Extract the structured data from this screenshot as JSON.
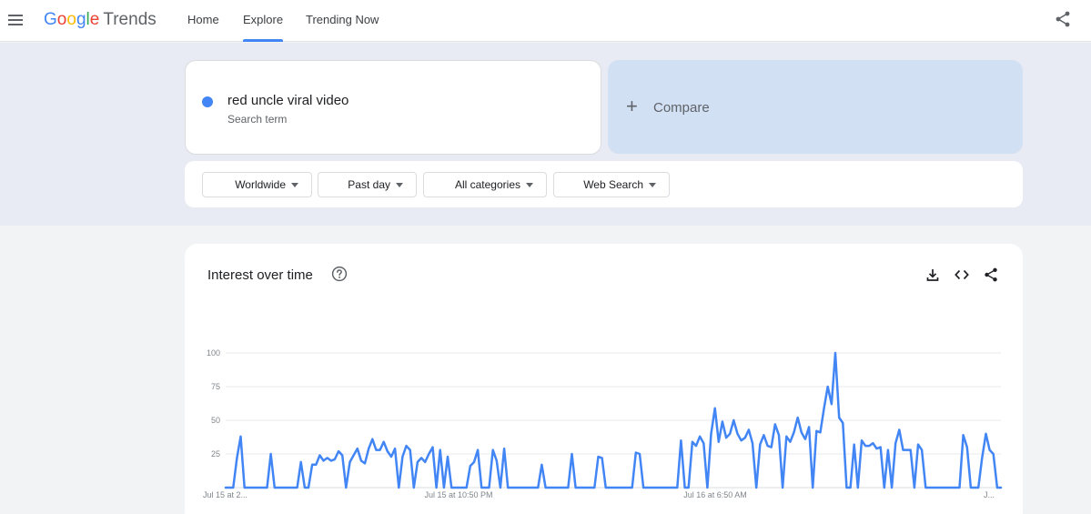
{
  "header": {
    "logo_letters": [
      "G",
      "o",
      "o",
      "g",
      "l",
      "e"
    ],
    "logo_product": "Trends",
    "tabs": [
      {
        "label": "Home",
        "active": false
      },
      {
        "label": "Explore",
        "active": true
      },
      {
        "label": "Trending Now",
        "active": false
      }
    ],
    "icons": {
      "menu": "menu-icon",
      "share": "share-icon"
    }
  },
  "search": {
    "term": {
      "name": "red uncle viral video",
      "subtitle": "Search term",
      "color": "#4285f4"
    },
    "compare": {
      "plus": "+",
      "label": "Compare"
    }
  },
  "filters": [
    {
      "label": "Worldwide"
    },
    {
      "label": "Past day"
    },
    {
      "label": "All categories"
    },
    {
      "label": "Web Search"
    }
  ],
  "chart_card": {
    "title": "Interest over time",
    "icons": [
      "help-icon",
      "download-icon",
      "embed-icon",
      "share-icon"
    ]
  },
  "chart_data": {
    "type": "line",
    "title": "Interest over time",
    "xlabel": "",
    "ylabel": "",
    "ylim": [
      0,
      100
    ],
    "yticks": [
      25,
      50,
      75,
      100
    ],
    "grid": true,
    "legend": "none",
    "x_tick_labels": [
      "Jul 15 at 2...",
      "Jul 15 at 10:50 PM",
      "Jul 16 at 6:50 AM",
      "J..."
    ],
    "series": [
      {
        "color": "#4285f4",
        "values": [
          0,
          0,
          0,
          22,
          38,
          0,
          0,
          0,
          0,
          0,
          0,
          0,
          25,
          0,
          0,
          0,
          0,
          0,
          0,
          0,
          19,
          0,
          0,
          17,
          17,
          24,
          20,
          22,
          20,
          21,
          27,
          24,
          0,
          19,
          24,
          29,
          20,
          18,
          29,
          36,
          28,
          28,
          34,
          27,
          23,
          29,
          0,
          23,
          31,
          28,
          0,
          19,
          22,
          19,
          25,
          30,
          0,
          28,
          0,
          23,
          0,
          0,
          0,
          0,
          0,
          16,
          19,
          28,
          0,
          0,
          0,
          28,
          20,
          0,
          29,
          0,
          0,
          0,
          0,
          0,
          0,
          0,
          0,
          0,
          17,
          0,
          0,
          0,
          0,
          0,
          0,
          0,
          25,
          0,
          0,
          0,
          0,
          0,
          0,
          23,
          22,
          0,
          0,
          0,
          0,
          0,
          0,
          0,
          0,
          26,
          25,
          0,
          0,
          0,
          0,
          0,
          0,
          0,
          0,
          0,
          0,
          35,
          0,
          0,
          34,
          31,
          38,
          33,
          0,
          40,
          59,
          34,
          49,
          37,
          40,
          50,
          40,
          35,
          37,
          43,
          33,
          0,
          32,
          39,
          31,
          30,
          47,
          39,
          0,
          38,
          34,
          41,
          52,
          41,
          36,
          45,
          0,
          42,
          41,
          59,
          75,
          62,
          100,
          52,
          48,
          0,
          0,
          32,
          0,
          35,
          31,
          31,
          33,
          29,
          30,
          0,
          28,
          0,
          33,
          43,
          28,
          28,
          28,
          0,
          32,
          28,
          0,
          0,
          0,
          0,
          0,
          0,
          0,
          0,
          0,
          0,
          39,
          30,
          0,
          0,
          0,
          22,
          40,
          28,
          25,
          0,
          0
        ]
      }
    ]
  }
}
